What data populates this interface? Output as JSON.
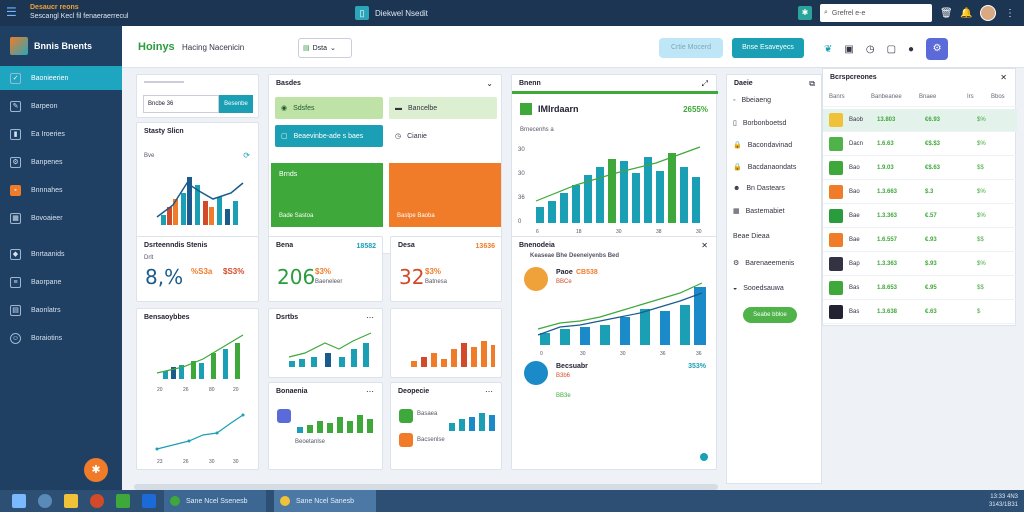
{
  "topbar": {
    "app_line1": "Desaucr reons",
    "app_line2": "Sescangl Kecl fil fenaeraerrecul",
    "window_title": "Diekwel Nsedit",
    "search_placeholder": "Grefrel e-e"
  },
  "sidebar": {
    "brand": "Bnnis Bnents",
    "items": [
      {
        "label": "Baonieerien"
      },
      {
        "label": "Barpeon"
      },
      {
        "label": "Ea Iroeries"
      },
      {
        "label": "Banpenes"
      },
      {
        "label": "Bnnnahes"
      },
      {
        "label": "Bovoaieer"
      },
      {
        "label": "Bnrtaanids"
      },
      {
        "label": "Baorpane"
      },
      {
        "label": "Baonlatrs"
      },
      {
        "label": "Boraiotins"
      }
    ]
  },
  "header": {
    "title_bold": "Hoinys",
    "title_rest": "Hacing Nacenicin",
    "dropdown": "Dsta",
    "btn_light": "Crtie Mocerd",
    "btn_primary": "Bnse Esaveyecs"
  },
  "cards": {
    "c1": {
      "search_value": "Bncbe 36",
      "search_btn": "Besenbe"
    },
    "c2": {
      "title": "Stasty Slicn",
      "sub": "Bve"
    },
    "c3": {
      "title": "Basdes",
      "opt1": "Sdsfes",
      "opt2": "Bancelbe",
      "opt3": "Beaevinbe-ade s baes",
      "opt4": "Cianie"
    },
    "c3_green": {
      "title": "Brnds",
      "foot": "Bade Sastoa"
    },
    "c3_orange": {
      "foot": "Bastpe Baoba"
    },
    "c4": {
      "title": "Bnenn",
      "chart_title": "IMIrdaarn",
      "pct": "2655%",
      "sub": "Brnecenhs a"
    },
    "c5": {
      "title": "Dsrteenndis Stenis",
      "sub": "Drlt",
      "big": "8,%",
      "pct": "%S3a",
      "pct2": "$S3%"
    },
    "c6": {
      "title": "Bena",
      "val": "18582",
      "big": "206",
      "pct": "$3%",
      "sub": "Baeneleer"
    },
    "c7": {
      "title": "Desa",
      "val": "13636",
      "big": "32",
      "pct": "$3%",
      "sub": "Batnesa"
    },
    "c8": {
      "title": "Bnenodeia",
      "sub": "Keaseae Bhe Deeneiyenbs Bed",
      "item1": "Paoe",
      "item1_val": "CB538",
      "item1_sub": "BBCe",
      "item2": "Becsuabr",
      "item2_val": "353%",
      "item2_sub": "B3b6",
      "item2_sub2": "BB3e"
    },
    "c9": {
      "title": "Bensaoybbes"
    },
    "c10": {
      "title": "Dsrtbs"
    },
    "c11": {
      "title": "Bonaenia",
      "sub": "Beoetanlse"
    },
    "c12": {
      "title": "Deopecie",
      "sub": "Basaea",
      "sub2": "Bacsenlse"
    }
  },
  "right_panel": {
    "title": "Daeie",
    "items": [
      {
        "label": "Bbeiaeng"
      },
      {
        "label": "Borbonboetsd"
      },
      {
        "label": "Bacondavinad"
      },
      {
        "label": "Bacdanaondats"
      },
      {
        "label": "Bn Dastears"
      },
      {
        "label": "Bastemabiet"
      },
      {
        "label": "Beae Dieaa"
      },
      {
        "label": "Barenaeemenis"
      },
      {
        "label": "Sooedsauwa"
      }
    ],
    "action": "Seabe bbloe"
  },
  "table": {
    "title": "Bcrspcreones",
    "columns": [
      "Banrs",
      "Banbeanee",
      "Bnaee",
      "Irs",
      "Bbos"
    ],
    "rows": [
      {
        "name": "Baob",
        "num": "13.803",
        "val": "€6.93",
        "tail": "$%",
        "color": "#f0c23a"
      },
      {
        "name": "Dacn",
        "num": "1.6.63",
        "val": "€$.$3",
        "tail": "$%",
        "color": "#4fb34a"
      },
      {
        "name": "Bao",
        "num": "1.9.03",
        "val": "€$.63",
        "tail": "$$",
        "color": "#3fa83a"
      },
      {
        "name": "Bao",
        "num": "1.3.663",
        "val": "$.3",
        "tail": "$%",
        "color": "#f07c2a"
      },
      {
        "name": "Bae",
        "num": "1.3.363",
        "val": "€.57",
        "tail": "$%",
        "color": "#2a9c3e"
      },
      {
        "name": "Bae",
        "num": "1.6.557",
        "val": "€.93",
        "tail": "$$",
        "color": "#f07c2a"
      },
      {
        "name": "Bap",
        "num": "1.3.363",
        "val": "$.93",
        "tail": "$%",
        "color": "#334"
      },
      {
        "name": "Bas",
        "num": "1.8.653",
        "val": "€.95",
        "tail": "$$",
        "color": "#3fa83a"
      },
      {
        "name": "Bas",
        "num": "1.3.638",
        "val": "€.63",
        "tail": "$",
        "color": "#223"
      }
    ]
  },
  "taskbar": {
    "task1": "Sane Ncel Ssenesb",
    "task2": "Sane Ncel Sanesb",
    "time": "13:33 4N3",
    "date": "3143/1B31"
  },
  "colors": {
    "accent": "#1a9fb4",
    "brand_green": "#2a9c3e",
    "orange": "#f07c2a",
    "sidebar": "#1f3f63"
  }
}
